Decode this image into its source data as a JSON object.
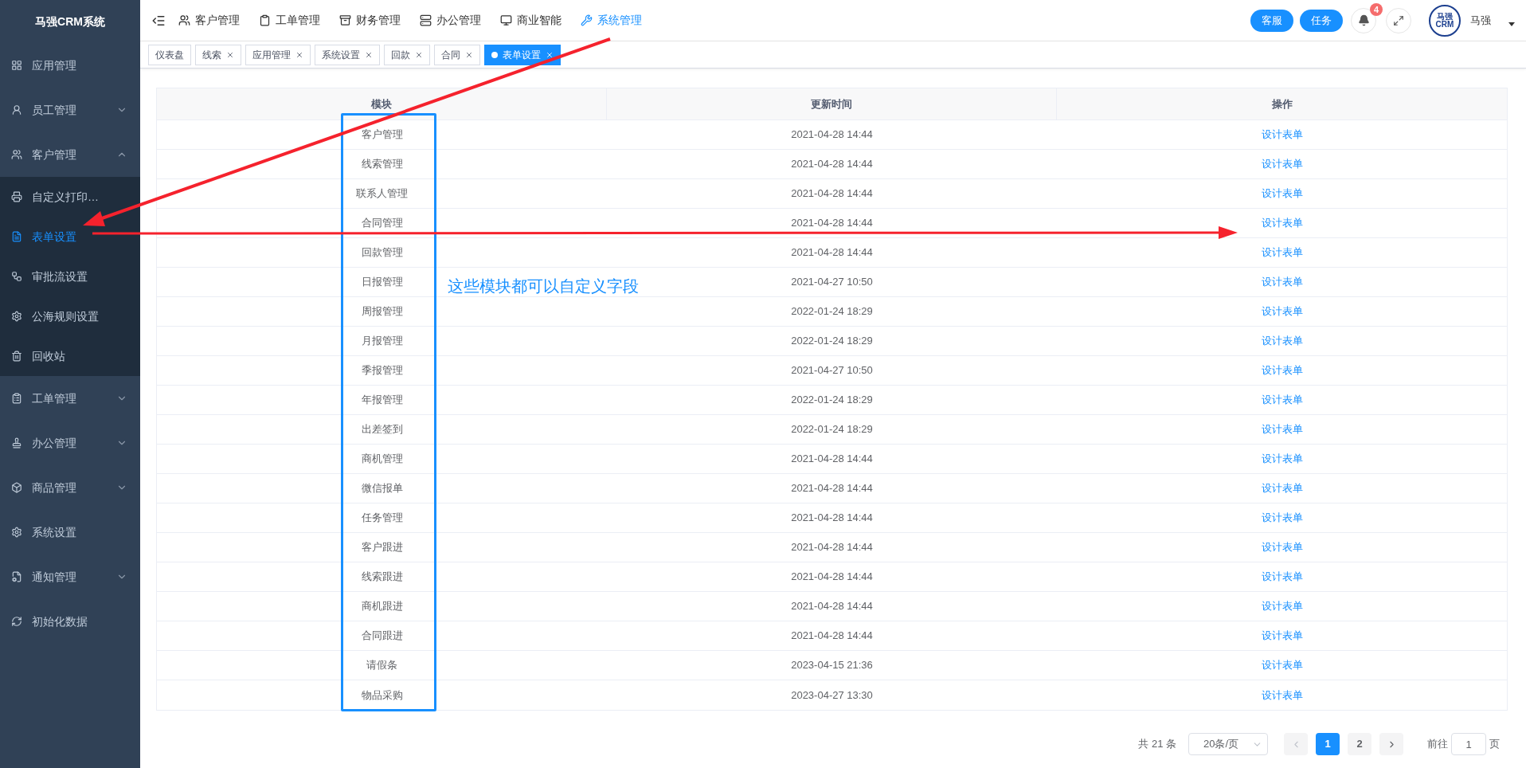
{
  "sidebar": {
    "title": "马强CRM系统",
    "items": [
      {
        "label": "应用管理",
        "selected": false
      },
      {
        "label": "员工管理",
        "expanded": false,
        "selected": false
      },
      {
        "label": "客户管理",
        "expanded": true,
        "selected": false,
        "children": [
          {
            "label": "自定义打印…",
            "selected": false
          },
          {
            "label": "表单设置",
            "selected": true
          },
          {
            "label": "审批流设置",
            "selected": false
          },
          {
            "label": "公海规则设置",
            "selected": false
          },
          {
            "label": "回收站",
            "selected": false
          }
        ]
      },
      {
        "label": "工单管理",
        "expanded": false,
        "selected": false
      },
      {
        "label": "办公管理",
        "expanded": false,
        "selected": false
      },
      {
        "label": "商品管理",
        "expanded": false,
        "selected": false
      },
      {
        "label": "系统设置",
        "selected": false
      },
      {
        "label": "通知管理",
        "expanded": false,
        "selected": false
      },
      {
        "label": "初始化数据",
        "selected": false
      }
    ]
  },
  "top_nav": [
    {
      "label": "客户管理",
      "selected": false
    },
    {
      "label": "工单管理",
      "selected": false
    },
    {
      "label": "财务管理",
      "selected": false
    },
    {
      "label": "办公管理",
      "selected": false
    },
    {
      "label": "商业智能",
      "selected": false
    },
    {
      "label": "系统管理",
      "selected": true
    }
  ],
  "header_buttons": [
    "客服",
    "任务"
  ],
  "notification_count": "4",
  "user": {
    "logo_line1": "马强",
    "logo_line2": "CRM",
    "name": "马强"
  },
  "tabs": [
    {
      "label": "仪表盘",
      "closable": false,
      "selected": false
    },
    {
      "label": "线索",
      "closable": true,
      "selected": false
    },
    {
      "label": "应用管理",
      "closable": true,
      "selected": false
    },
    {
      "label": "系统设置",
      "closable": true,
      "selected": false
    },
    {
      "label": "回款",
      "closable": true,
      "selected": false
    },
    {
      "label": "合同",
      "closable": true,
      "selected": false
    },
    {
      "label": "表单设置",
      "closable": true,
      "selected": true
    }
  ],
  "table": {
    "columns": [
      "模块",
      "更新时间",
      "操作"
    ],
    "rows": [
      {
        "module": "客户管理",
        "updated": "2021-04-28 14:44",
        "action": "设计表单"
      },
      {
        "module": "线索管理",
        "updated": "2021-04-28 14:44",
        "action": "设计表单"
      },
      {
        "module": "联系人管理",
        "updated": "2021-04-28 14:44",
        "action": "设计表单"
      },
      {
        "module": "合同管理",
        "updated": "2021-04-28 14:44",
        "action": "设计表单"
      },
      {
        "module": "回款管理",
        "updated": "2021-04-28 14:44",
        "action": "设计表单"
      },
      {
        "module": "日报管理",
        "updated": "2021-04-27 10:50",
        "action": "设计表单"
      },
      {
        "module": "周报管理",
        "updated": "2022-01-24 18:29",
        "action": "设计表单"
      },
      {
        "module": "月报管理",
        "updated": "2022-01-24 18:29",
        "action": "设计表单"
      },
      {
        "module": "季报管理",
        "updated": "2021-04-27 10:50",
        "action": "设计表单"
      },
      {
        "module": "年报管理",
        "updated": "2022-01-24 18:29",
        "action": "设计表单"
      },
      {
        "module": "出差签到",
        "updated": "2022-01-24 18:29",
        "action": "设计表单"
      },
      {
        "module": "商机管理",
        "updated": "2021-04-28 14:44",
        "action": "设计表单"
      },
      {
        "module": "微信报单",
        "updated": "2021-04-28 14:44",
        "action": "设计表单"
      },
      {
        "module": "任务管理",
        "updated": "2021-04-28 14:44",
        "action": "设计表单"
      },
      {
        "module": "客户跟进",
        "updated": "2021-04-28 14:44",
        "action": "设计表单"
      },
      {
        "module": "线索跟进",
        "updated": "2021-04-28 14:44",
        "action": "设计表单"
      },
      {
        "module": "商机跟进",
        "updated": "2021-04-28 14:44",
        "action": "设计表单"
      },
      {
        "module": "合同跟进",
        "updated": "2021-04-28 14:44",
        "action": "设计表单"
      },
      {
        "module": "请假条",
        "updated": "2023-04-15 21:36",
        "action": "设计表单"
      },
      {
        "module": "物品采购",
        "updated": "2023-04-27 13:30",
        "action": "设计表单"
      }
    ]
  },
  "pagination": {
    "total": "共 21 条",
    "page_size": "20条/页",
    "pages": [
      {
        "label": "1",
        "selected": true
      },
      {
        "label": "2",
        "selected": false
      }
    ],
    "goto_label": "前往",
    "goto_value": "1",
    "goto_suffix": "页"
  },
  "annotation": {
    "text": "这些模块都可以自定义字段"
  }
}
